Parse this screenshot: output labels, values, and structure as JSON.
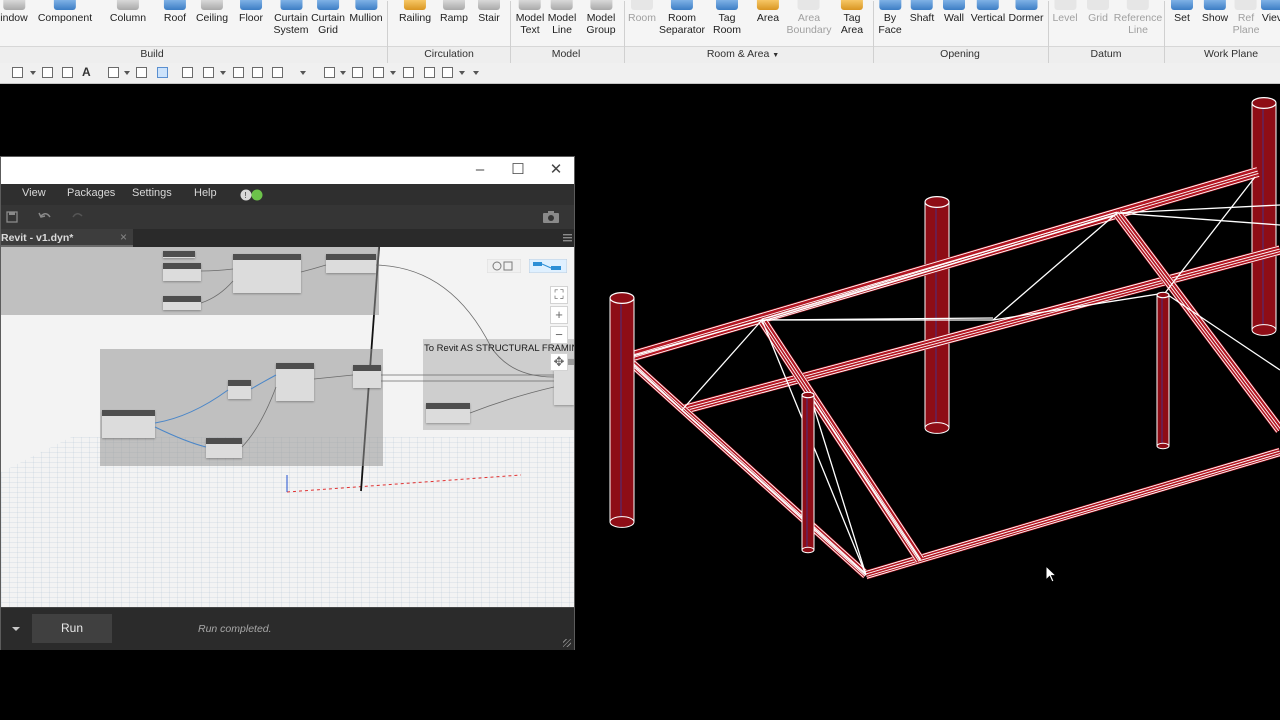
{
  "ribbon": {
    "buttons": [
      {
        "label": "indow",
        "line2": ""
      },
      {
        "label": "Component",
        "line2": ""
      },
      {
        "label": "Column",
        "line2": ""
      },
      {
        "label": "Roof",
        "line2": ""
      },
      {
        "label": "Ceiling",
        "line2": ""
      },
      {
        "label": "Floor",
        "line2": ""
      },
      {
        "label": "Curtain",
        "line2": "System"
      },
      {
        "label": "Curtain",
        "line2": "Grid"
      },
      {
        "label": "Mullion",
        "line2": ""
      },
      {
        "label": "Railing",
        "line2": ""
      },
      {
        "label": "Ramp",
        "line2": ""
      },
      {
        "label": "Stair",
        "line2": ""
      },
      {
        "label": "Model",
        "line2": "Text"
      },
      {
        "label": "Model",
        "line2": "Line"
      },
      {
        "label": "Model",
        "line2": "Group"
      },
      {
        "label": "Room",
        "line2": ""
      },
      {
        "label": "Room",
        "line2": "Separator"
      },
      {
        "label": "Tag",
        "line2": "Room"
      },
      {
        "label": "Area",
        "line2": ""
      },
      {
        "label": "Area",
        "line2": "Boundary"
      },
      {
        "label": "Tag",
        "line2": "Area"
      },
      {
        "label": "By",
        "line2": "Face"
      },
      {
        "label": "Shaft",
        "line2": ""
      },
      {
        "label": "Wall",
        "line2": ""
      },
      {
        "label": "Vertical",
        "line2": ""
      },
      {
        "label": "Dormer",
        "line2": ""
      },
      {
        "label": "Level",
        "line2": ""
      },
      {
        "label": "Grid",
        "line2": ""
      },
      {
        "label": "Reference",
        "line2": "Line"
      },
      {
        "label": "Set",
        "line2": ""
      },
      {
        "label": "Show",
        "line2": ""
      },
      {
        "label": "Ref",
        "line2": "Plane"
      },
      {
        "label": "Viev",
        "line2": ""
      }
    ],
    "panels": [
      "Build",
      "Circulation",
      "Model",
      "Room & Area",
      "Opening",
      "Datum",
      "Work Plane"
    ]
  },
  "dynamo": {
    "menu": [
      "View",
      "Packages",
      "Settings",
      "Help"
    ],
    "tab_label": "Revit - v1.dyn*",
    "tab_close": "×",
    "window_controls": {
      "minimize": "–",
      "maximize": "☐",
      "close": "✕"
    },
    "node_label": "To Revit AS STRUCTURAL FRAMING",
    "run_label": "Run",
    "run_status": "Run completed."
  },
  "colors": {
    "beam_red": "#b31622",
    "beam_line": "#ffffff",
    "column_red": "#8e0d16",
    "ribbon_bg": "#f5f5f5",
    "dynamo_dark": "#2f2f2f"
  },
  "icons": [
    "window-icon",
    "component-icon",
    "column-icon",
    "roof-icon",
    "ceiling-icon",
    "floor-icon",
    "undo-icon",
    "redo-icon",
    "save-icon",
    "camera-icon",
    "zoom-extents-icon",
    "zoom-in-icon",
    "zoom-out-icon",
    "pan-icon",
    "mouse-cursor-icon"
  ]
}
